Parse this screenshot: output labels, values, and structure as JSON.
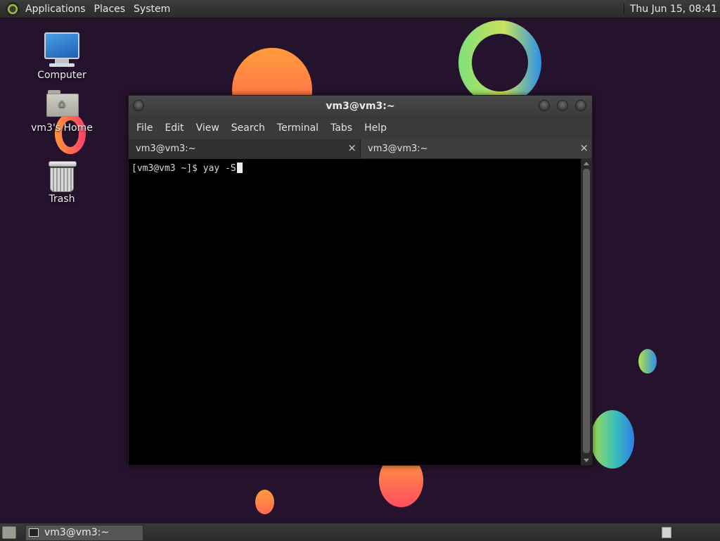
{
  "top_panel": {
    "menus": [
      "Applications",
      "Places",
      "System"
    ],
    "clock": "Thu Jun 15, 08:41"
  },
  "desktop": {
    "icons": [
      {
        "label": "Computer",
        "icon": "computer-icon"
      },
      {
        "label": "vm3's Home",
        "icon": "home-folder-icon"
      },
      {
        "label": "Trash",
        "icon": "trash-icon"
      }
    ]
  },
  "terminal": {
    "title": "vm3@vm3:~",
    "menu": [
      "File",
      "Edit",
      "View",
      "Search",
      "Terminal",
      "Tabs",
      "Help"
    ],
    "tabs": [
      {
        "label": "vm3@vm3:~",
        "close": "×"
      },
      {
        "label": "vm3@vm3:~",
        "close": "×"
      }
    ],
    "prompt": "[vm3@vm3 ~]$ ",
    "command": "yay -S"
  },
  "taskbar": {
    "items": [
      {
        "label": "vm3@vm3:~"
      }
    ]
  }
}
